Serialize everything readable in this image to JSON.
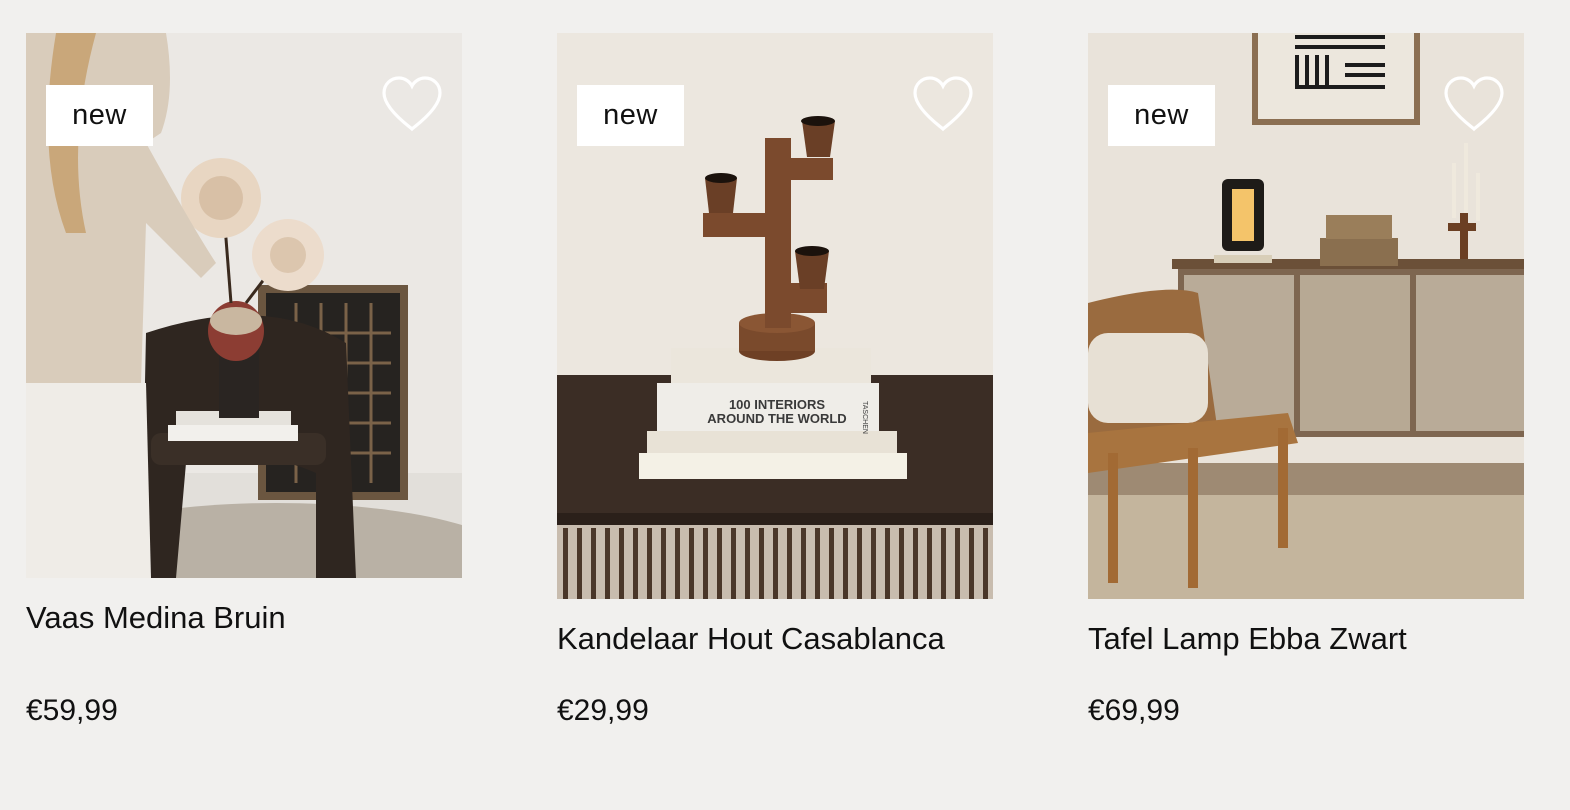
{
  "products": [
    {
      "badge": "new",
      "title": "Vaas Medina Bruin",
      "price": "€59,99",
      "wishlist_icon": "heart-outline-icon"
    },
    {
      "badge": "new",
      "title": "Kandelaar Hout Casablanca",
      "price": "€29,99",
      "wishlist_icon": "heart-outline-icon"
    },
    {
      "badge": "new",
      "title": "Tafel Lamp Ebba Zwart",
      "price": "€69,99",
      "wishlist_icon": "heart-outline-icon"
    }
  ],
  "book_spine": {
    "line1": "100 INTERIORS",
    "line2": "AROUND THE WORLD",
    "publisher": "TASCHEN"
  },
  "colors": {
    "background": "#f1f0ee",
    "badge_bg": "#ffffff",
    "text": "#111111"
  }
}
